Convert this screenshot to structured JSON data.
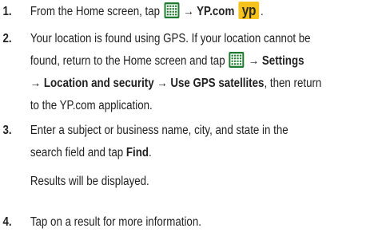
{
  "icons": {
    "apps": "apps-grid-icon",
    "yp": "yp-app-icon",
    "yp_text": "yp",
    "apps_color": "#1e7a2f",
    "yp_color": "#f6c21c"
  },
  "steps": [
    {
      "number": "1.",
      "t1": "From the Home screen, tap",
      "t2": "→ YP.com",
      "t3": "."
    },
    {
      "number": "2.",
      "l1": "Your location is found using GPS. If your location cannot be",
      "l2a": "found, return to the Home screen and tap",
      "l2b": "→ Settings",
      "l3": "→ Location and security → Use GPS satellites",
      "l3b": ", then return",
      "l4": "to the YP.com application."
    },
    {
      "number": "3.",
      "l1": "Enter a subject or business name, city, and state in the",
      "l2a": "search field and tap ",
      "l2b": "Find",
      "l2c": ".",
      "note": "Results will be displayed."
    },
    {
      "number": "4.",
      "l1": "Tap on a result for more information."
    }
  ]
}
